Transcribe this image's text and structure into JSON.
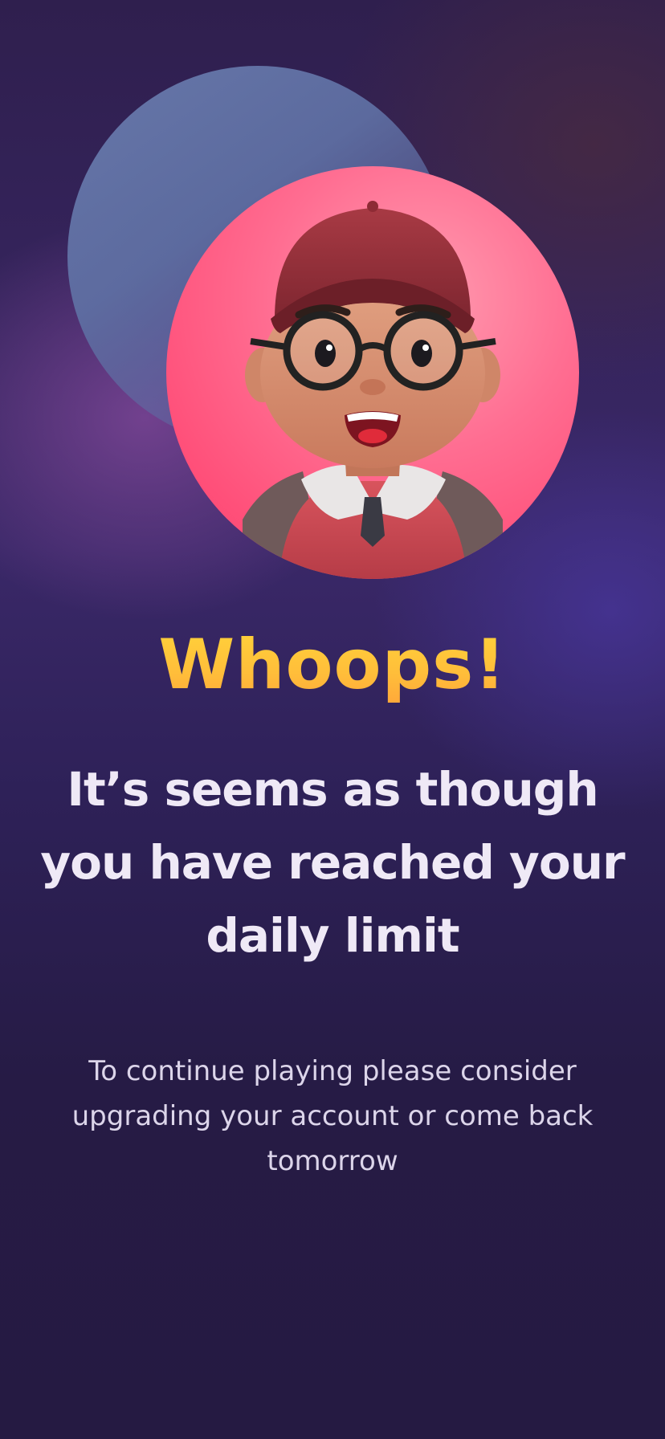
{
  "screen": {
    "title": "Whoops!",
    "subtitle": "It’s seems as though you have reached your daily limit",
    "message": "To continue playing please consider upgrading your account or come back tomorrow"
  },
  "illustration": {
    "icon": "cartoon-avatar-icon",
    "background_color": "#ff5a82",
    "accent_circle_color": "#6a7cae"
  },
  "colors": {
    "title": "#ffc13b",
    "subtitle": "#efe9f6",
    "message": "#dcd5ea",
    "background": "#2a1d4c"
  }
}
